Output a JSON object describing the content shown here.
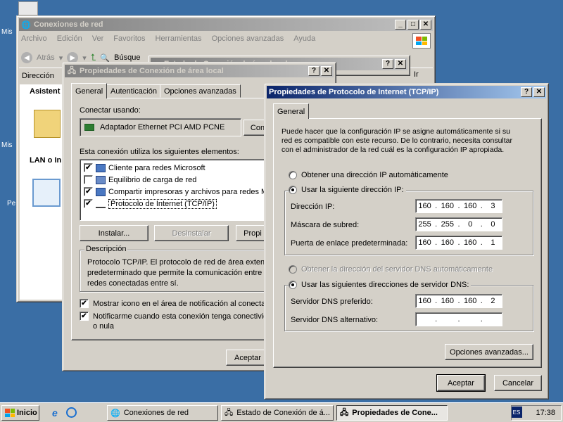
{
  "desktop": {
    "labels": [
      "Mis",
      "Mis",
      "Pe",
      "",
      "Ir",
      "Ir"
    ]
  },
  "explorer": {
    "title": "Conexiones de red",
    "menu": [
      "Archivo",
      "Edición",
      "Ver",
      "Favoritos",
      "Herramientas",
      "Opciones avanzadas",
      "Ayuda"
    ],
    "back_label": "Atrás",
    "search_label": "Búsque",
    "address_label": "Dirección",
    "go_label": "Ir",
    "side_heading_1": "Asistent",
    "side_heading_2": "LAN o In"
  },
  "status_window": {
    "title": "Estado de Conexión de área local"
  },
  "lan_props": {
    "title": "Propiedades de Conexión de área local",
    "tabs": [
      "General",
      "Autenticación",
      "Opciones avanzadas"
    ],
    "connect_using_label": "Conectar usando:",
    "adapter_name": "Adaptador Ethernet PCI AMD PCNE",
    "configure_button": "Con",
    "items_label": "Esta conexión utiliza los siguientes elementos:",
    "items": [
      {
        "label": "Cliente para redes Microsoft",
        "checked": true
      },
      {
        "label": "Equilibrio de carga de red",
        "checked": false
      },
      {
        "label": "Compartir impresoras y archivos para redes Mic",
        "checked": true
      },
      {
        "label": "Protocolo de Internet (TCP/IP)",
        "checked": true
      }
    ],
    "install_button": "Instalar...",
    "uninstall_button": "Desinstalar",
    "properties_button": "Propi",
    "description_title": "Descripción",
    "description_lines": [
      "Protocolo TCP/IP. El protocolo de red de área extens",
      "predeterminado que permite la comunicación entre va",
      "redes conectadas entre sí."
    ],
    "show_icon_label": "Mostrar icono en el área de notificación al conectars",
    "notify_label_1": "Notificarme cuando esta conexión tenga conectivid",
    "notify_label_2": "o nula",
    "accept_button": "Aceptar"
  },
  "tcpip": {
    "title": "Propiedades de Protocolo de Internet (TCP/IP)",
    "tab": "General",
    "intro_lines": [
      "Puede hacer que la configuración IP se asigne automáticamente si su",
      "red es compatible con este recurso. De lo contrario, necesita consultar",
      "con el administrador de la red cuál es la configuración IP apropiada."
    ],
    "auto_ip_label": "Obtener una dirección IP automáticamente",
    "manual_ip_label": "Usar la siguiente dirección IP:",
    "ip_fields": [
      {
        "label": "Dirección IP:",
        "octets": [
          "160",
          "160",
          "160",
          "3"
        ]
      },
      {
        "label": "Máscara de subred:",
        "octets": [
          "255",
          "255",
          "0",
          "0"
        ]
      },
      {
        "label": "Puerta de enlace predeterminada:",
        "octets": [
          "160",
          "160",
          "160",
          "1"
        ]
      }
    ],
    "auto_dns_label": "Obtener la dirección del servidor DNS automáticamente",
    "manual_dns_label": "Usar las siguientes direcciones de servidor DNS:",
    "dns_fields": [
      {
        "label": "Servidor DNS preferido:",
        "octets": [
          "160",
          "160",
          "160",
          "2"
        ]
      },
      {
        "label": "Servidor DNS alternativo:",
        "octets": [
          "",
          "",
          "",
          ""
        ]
      }
    ],
    "advanced_button": "Opciones avanzadas...",
    "accept_button": "Aceptar",
    "cancel_button": "Cancelar",
    "selected_ip_mode": "manual",
    "selected_dns_mode": "manual"
  },
  "taskbar": {
    "start_label": "Inicio",
    "tasks": [
      "Conexiones de red",
      "Estado de Conexión de á...",
      "Propiedades de Cone..."
    ],
    "tray_lang": "ES",
    "clock": "17:38"
  },
  "colors": {
    "desktop": "#3a6ea5",
    "active_title": "#0a246a",
    "face": "#d4d0c8"
  }
}
